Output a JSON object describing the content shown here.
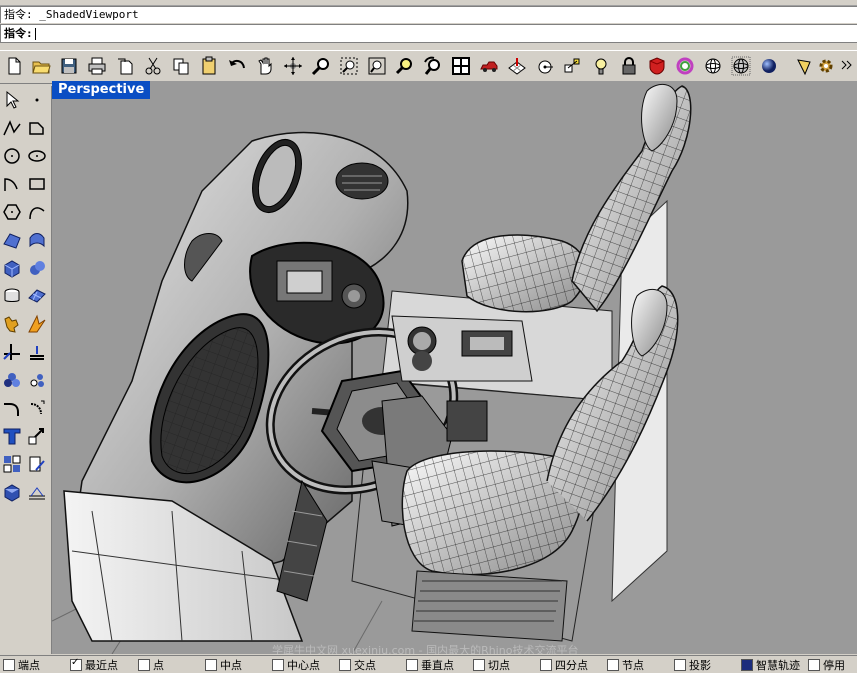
{
  "command": {
    "history_text": "指令: _ShadedViewport",
    "prompt_text": "指令:"
  },
  "toolbar": {
    "icons": [
      "new-file-icon",
      "open-folder-icon",
      "save-icon",
      "print-icon",
      "import-icon",
      "cut-icon",
      "copy-icon",
      "paste-icon",
      "undo-icon",
      "pan-hand-icon",
      "rotate-view-icon",
      "zoom-icon",
      "zoom-window-icon",
      "zoom-extents-icon",
      "zoom-selected-icon",
      "undo-view-icon",
      "four-viewports-icon",
      "car-icon",
      "grid-plane-icon",
      "cplane-icon",
      "osnap-icon",
      "light-bulb-icon",
      "lock-icon",
      "shade-icon",
      "render-color-icon",
      "wireframe-sphere-icon",
      "ghosted-sphere-icon",
      "rendered-sphere-icon",
      "render-icon",
      "gear-icon",
      "more-icon"
    ]
  },
  "left_toolbar": {
    "icons": [
      "select-arrow-icon",
      "point-icon",
      "polyline-icon",
      "rectangle-icon",
      "circle-icon",
      "ellipse-icon",
      "arc-icon",
      "rectangle-tool-icon",
      "polygon-icon",
      "curve-icon",
      "surface-patch-icon",
      "surface-edge-icon",
      "box-solid-icon",
      "sphere-solid-icon",
      "extrude-icon",
      "surface-grid-icon",
      "transform-icon",
      "boolean-icon",
      "trim-icon",
      "split-icon",
      "group-icon",
      "spheres-icon",
      "fillet-icon",
      "scale-icon",
      "text-icon",
      "array-icon",
      "layer-icon",
      "properties-icon",
      "solid-box-icon",
      "dimension-icon"
    ]
  },
  "viewport": {
    "title": "Perspective",
    "watermark": "学犀牛中文网  xuexiniu.com  -  国内最大的Rhino技术交流平台"
  },
  "status": {
    "snaps": [
      {
        "label": "端点",
        "checked": false
      },
      {
        "label": "最近点",
        "checked": true
      },
      {
        "label": "点",
        "checked": false
      },
      {
        "label": "中点",
        "checked": false
      },
      {
        "label": "中心点",
        "checked": false
      },
      {
        "label": "交点",
        "checked": false
      },
      {
        "label": "垂直点",
        "checked": false
      },
      {
        "label": "切点",
        "checked": false
      },
      {
        "label": "四分点",
        "checked": false
      },
      {
        "label": "节点",
        "checked": false
      },
      {
        "label": "投影",
        "checked": false
      },
      {
        "label": "智慧轨迹",
        "checked": false,
        "filled": true
      },
      {
        "label": "停用",
        "checked": false
      }
    ]
  }
}
